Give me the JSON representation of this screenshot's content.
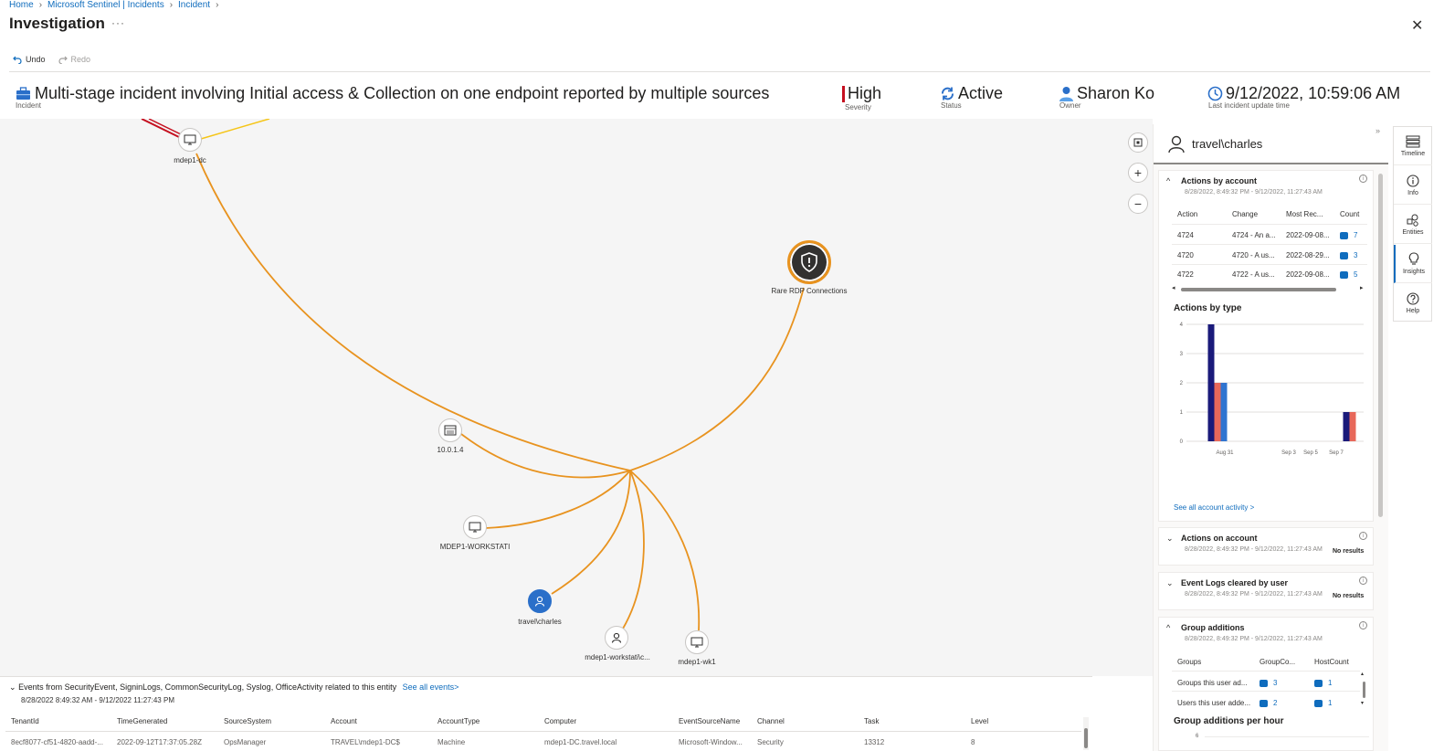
{
  "breadcrumb": [
    "Home",
    "Microsoft Sentinel | Incidents",
    "Incident"
  ],
  "page": {
    "title": "Investigation",
    "more": "···",
    "close": "✕"
  },
  "toolbar": {
    "undo": "Undo",
    "redo": "Redo"
  },
  "incident": {
    "title": "Multi-stage incident involving Initial access & Collection on one endpoint reported by multiple sources",
    "title_label": "Incident",
    "severity": "High",
    "severity_label": "Severity",
    "status": "Active",
    "status_label": "Status",
    "owner": "Sharon Ko",
    "owner_label": "Owner",
    "updated": "9/12/2022, 10:59:06 AM",
    "updated_label": "Last incident update time"
  },
  "graph": {
    "nodes": {
      "dc": "mdep1-dc",
      "alert": "Rare RDP Connections",
      "ip": "10.0.1.4",
      "workstation": "MDEP1-WORKSTATI",
      "user": "travel\\charles",
      "account2": "mdep1-workstati\\c...",
      "wk1": "mdep1-wk1"
    },
    "colors": {
      "edge": "#e8931f",
      "edge_red": "#c50f1f",
      "edge_yellow": "#f5c518",
      "user_node": "#2a6fc9"
    }
  },
  "events": {
    "title": "Events from SecurityEvent, SigninLogs, CommonSecurityLog, Syslog, OfficeActivity related to this entity",
    "see_all": "See all events>",
    "range": "8/28/2022 8:49:32 AM - 9/12/2022 11:27:43 PM",
    "headers": [
      "TenantId",
      "TimeGenerated",
      "SourceSystem",
      "Account",
      "AccountType",
      "Computer",
      "EventSourceName",
      "Channel",
      "Task",
      "Level"
    ],
    "row": [
      "8ecf8077-cf51-4820-aadd-...",
      "2022-09-12T17:37:05.28Z",
      "OpsManager",
      "TRAVEL\\mdep1-DC$",
      "Machine",
      "mdep1-DC.travel.local",
      "Microsoft-Window...",
      "Security",
      "13312",
      "8"
    ]
  },
  "panel": {
    "entity": "travel\\charles",
    "actions_by_account": {
      "title": "Actions by account",
      "range": "8/28/2022, 8:49:32 PM - 9/12/2022, 11:27:43 AM",
      "headers": [
        "Action",
        "Change",
        "Most Rec...",
        "Count"
      ],
      "rows": [
        [
          "4724",
          "4724 - An a...",
          "2022-09-08...",
          "7"
        ],
        [
          "4720",
          "4720 - A us...",
          "2022-08-29...",
          "3"
        ],
        [
          "4722",
          "4722 - A us...",
          "2022-09-08...",
          "5"
        ]
      ]
    },
    "actions_by_type": {
      "title": "Actions by type",
      "link": "See all account activity >"
    },
    "actions_on_account": {
      "title": "Actions on account",
      "range": "8/28/2022, 8:49:32 PM - 9/12/2022, 11:27:43 AM",
      "result": "No results"
    },
    "event_logs_cleared": {
      "title": "Event Logs cleared by user",
      "range": "8/28/2022, 8:49:32 PM - 9/12/2022, 11:27:43 AM",
      "result": "No results"
    },
    "group_additions": {
      "title": "Group additions",
      "range": "8/28/2022, 8:49:32 PM - 9/12/2022, 11:27:43 AM",
      "headers": [
        "Groups",
        "GroupCo...",
        "HostCount"
      ],
      "rows": [
        [
          "Groups this user ad...",
          "3",
          "1"
        ],
        [
          "Users this user adde...",
          "2",
          "1"
        ]
      ]
    },
    "group_additions_per_hour": {
      "title": "Group additions per hour",
      "first_tick": "6"
    }
  },
  "sidetabs": [
    "Timeline",
    "Info",
    "Entities",
    "Insights",
    "Help"
  ],
  "chart_data": {
    "type": "bar",
    "title": "Actions by type",
    "x": [
      "Aug 31",
      "Sep 3",
      "Sep 5",
      "Sep 7"
    ],
    "ylim": [
      0,
      4
    ],
    "yticks": [
      "0",
      "1",
      "2",
      "3",
      "4"
    ],
    "series": [
      {
        "color": "#1a1a7a",
        "values": [
          4,
          0,
          0,
          1
        ]
      },
      {
        "color": "#e8685a",
        "values": [
          2,
          0,
          0,
          1
        ]
      },
      {
        "color": "#2f74d0",
        "values": [
          2,
          0,
          0,
          0
        ]
      }
    ],
    "grid": true
  }
}
